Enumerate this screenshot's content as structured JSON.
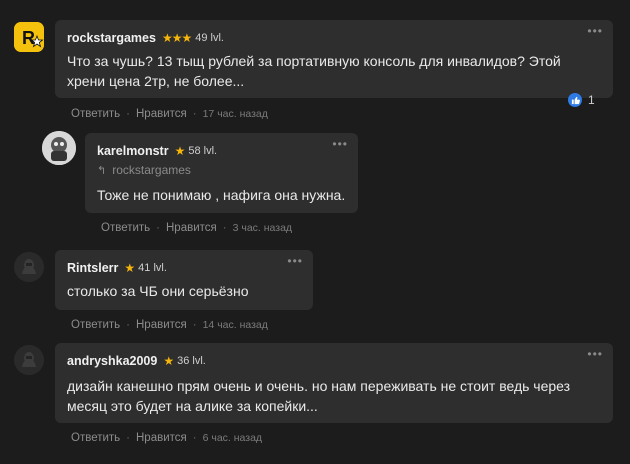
{
  "actions": {
    "reply_label": "Ответить",
    "like_label": "Нравится",
    "separator": "·"
  },
  "comments": [
    {
      "username": "rockstargames",
      "stars": "★★★",
      "level": "49 lvl.",
      "text": "Что за чушь? 13 тыщ рублей за портативную консоль для инвалидов? Этой хрени цена 2тр, не более...",
      "time": "17 час. назад",
      "likes": "1"
    },
    {
      "username": "karelmonstr",
      "stars": "★",
      "level": "58 lvl.",
      "reply_to": "rockstargames",
      "text": "Тоже не понимаю , нафига она нужна.",
      "time": "3 час. назад"
    },
    {
      "username": "Rintslerr",
      "stars": "★",
      "level": "41 lvl.",
      "text": "столько за ЧБ они серьёзно",
      "time": "14 час. назад"
    },
    {
      "username": "andryshka2009",
      "stars": "★",
      "level": "36 lvl.",
      "text": "дизайн канешно прям очень и очень. но нам переживать не стоит ведь через месяц это будет на алике за копейки...",
      "time": "6 час. назад"
    }
  ],
  "colors": {
    "background": "#1c1c1c",
    "bubble": "#2e2e2e",
    "star": "#f5b50a",
    "like": "#2f7be5"
  }
}
